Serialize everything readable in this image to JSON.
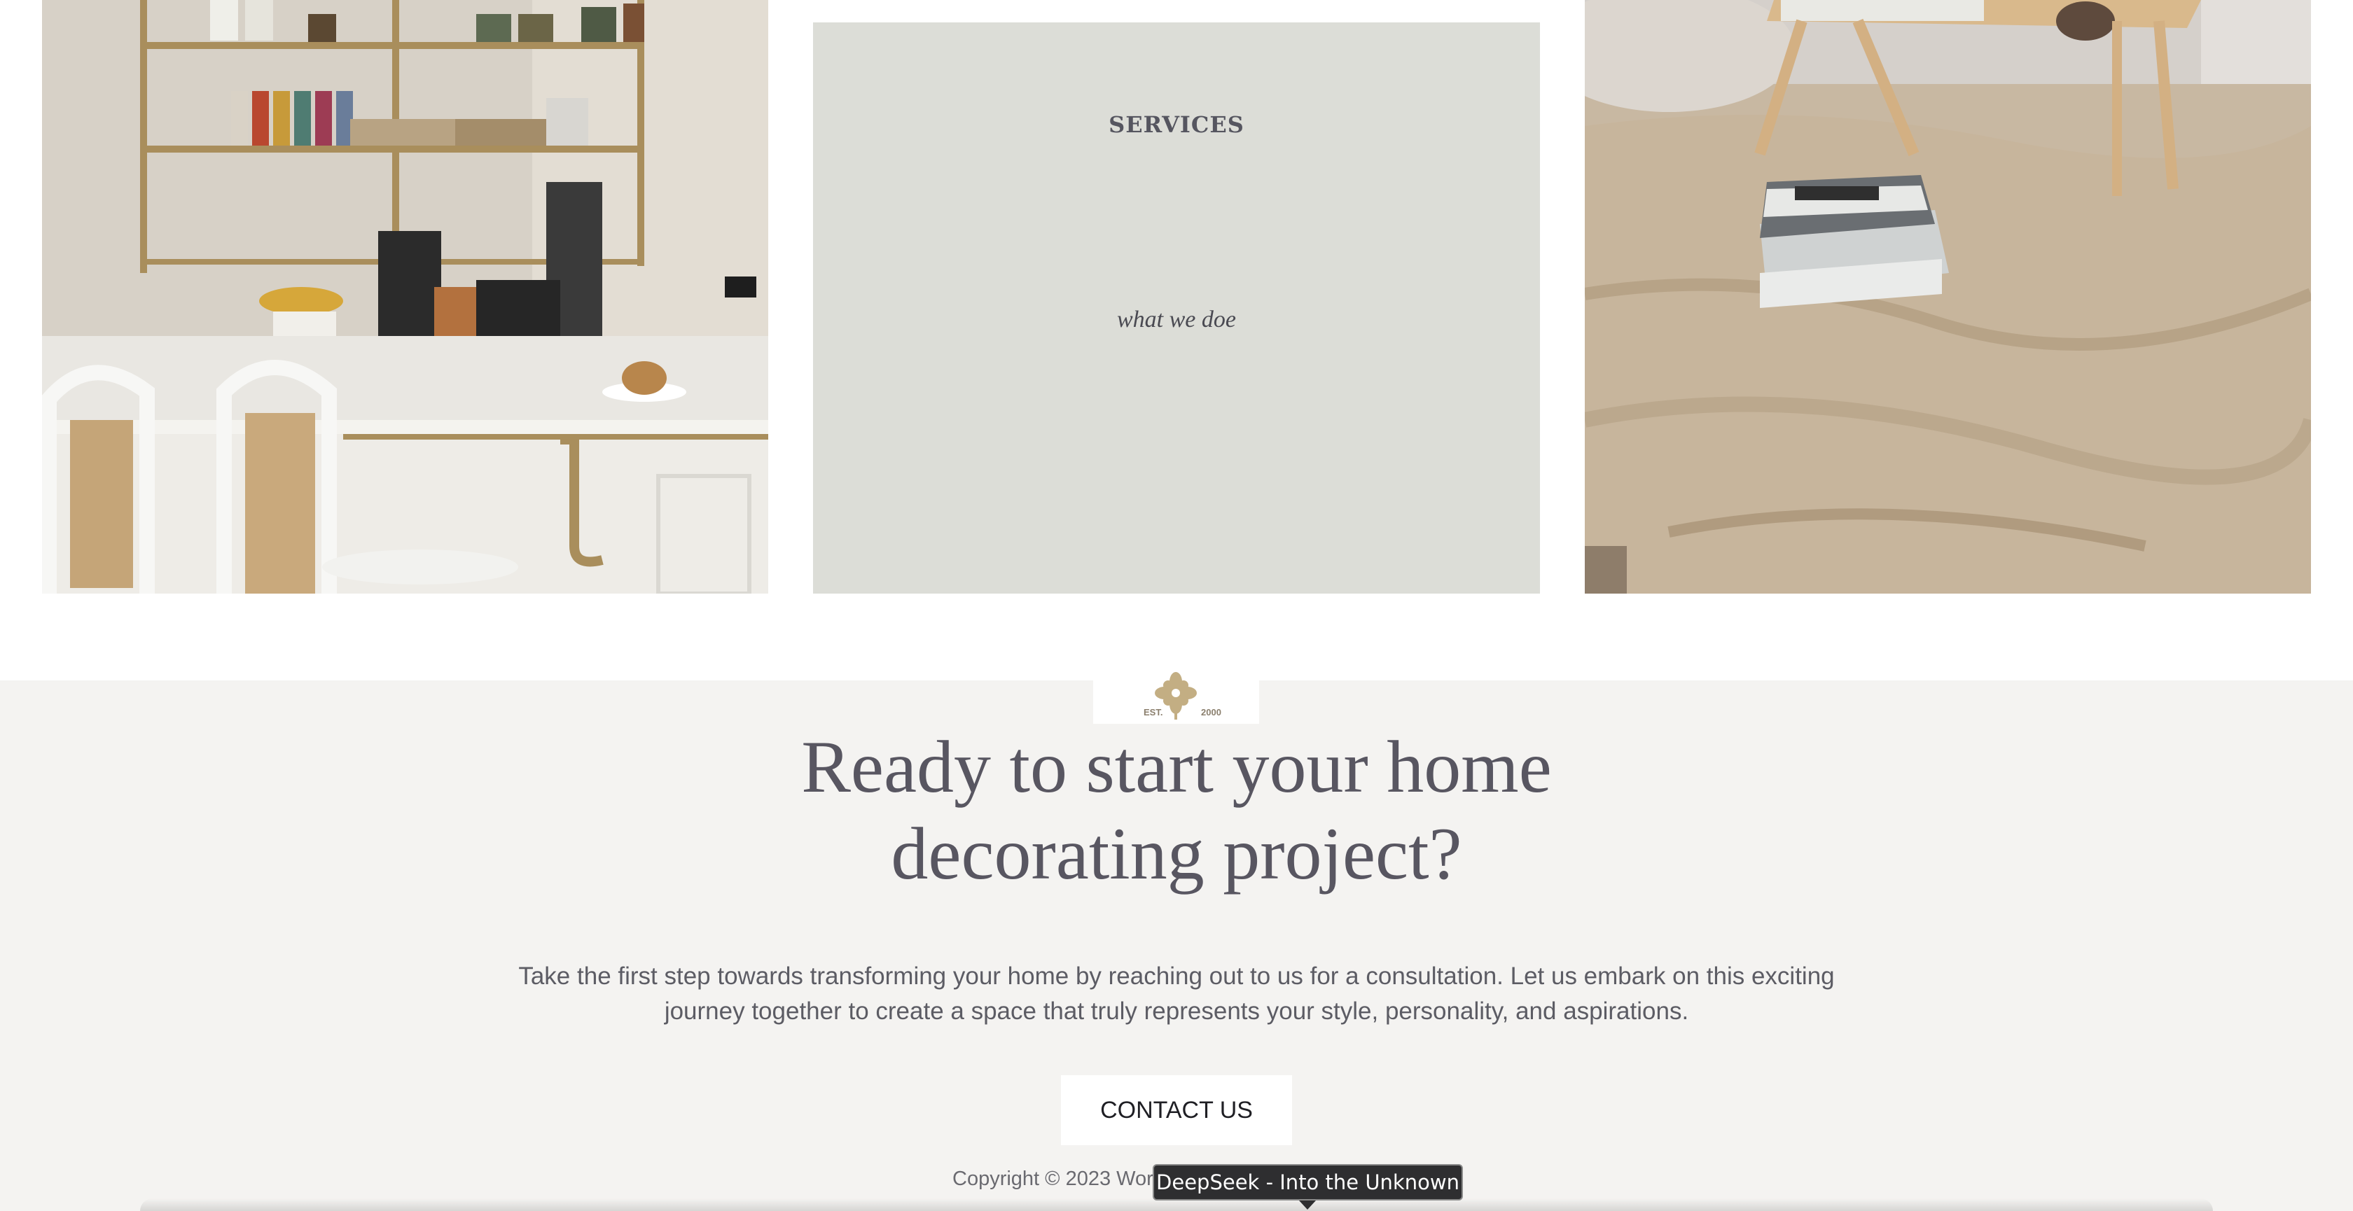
{
  "services": {
    "heading": "SERVICES",
    "subheading": "what we doe"
  },
  "logo": {
    "left_text": "EST.",
    "right_text": "2000"
  },
  "cta": {
    "title_line1": "Ready to start your home",
    "title_line2": "decorating project?",
    "body_line1": "Take the first step towards transforming your home by reaching out to us for a consultation. Let us embark on this exciting",
    "body_line2": "journey together to create a space that truly represents your style, personality, and aspirations.",
    "button_label": "CONTACT US"
  },
  "footer": {
    "copyright": "Copyright © 2023 Work"
  },
  "tooltip": {
    "text": "DeepSeek - Into the Unknown"
  },
  "colors": {
    "services_bg": "#dcddd7",
    "cta_bg": "#f4f3f1",
    "text_dark": "#585661",
    "logo_gold": "#c3ae83"
  },
  "images": {
    "left": "kitchen-photo",
    "right": "bedroom-photo"
  }
}
